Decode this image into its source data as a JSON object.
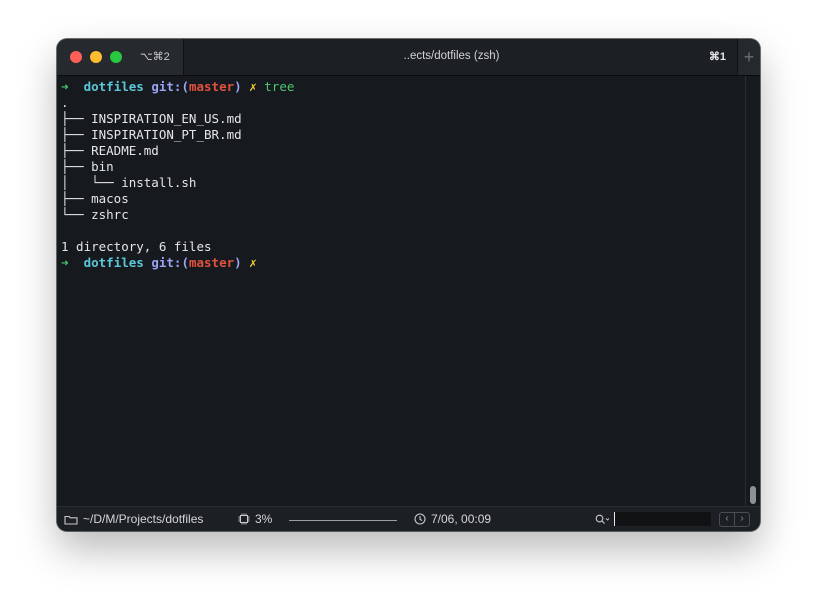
{
  "window": {
    "title": "..ects/dotfiles (zsh)",
    "tab_shortcut": "⌥⌘2",
    "active_shortcut": "⌘1",
    "new_tab_label": "+"
  },
  "terminal": {
    "prompt_arrow": "➜",
    "prompt_dir": "dotfiles",
    "prompt_git": "git:(",
    "prompt_branch": "master",
    "prompt_git_close": ")",
    "prompt_dirty": "✗",
    "command": "tree",
    "tree_lines": [
      ".",
      "├── INSPIRATION_EN_US.md",
      "├── INSPIRATION_PT_BR.md",
      "├── README.md",
      "├── bin",
      "│   └── install.sh",
      "├── macos",
      "└── zshrc"
    ],
    "blank": "",
    "summary": "1 directory, 6 files"
  },
  "statusbar": {
    "path": "~/D/M/Projects/dotfiles",
    "cpu": "3%",
    "clock": "7/06, 00:09"
  },
  "icons": {
    "folder": "folder-icon",
    "cpu": "cpu-icon",
    "clock": "clock-icon",
    "search": "search-icon"
  },
  "colors": {
    "arrow": "#4ec86f",
    "cwd": "#5ac8d8",
    "git": "#9aa2f5",
    "branch": "#e0523f",
    "dirty": "#f0d030",
    "command": "#4ec86f",
    "background": "#16191d"
  }
}
